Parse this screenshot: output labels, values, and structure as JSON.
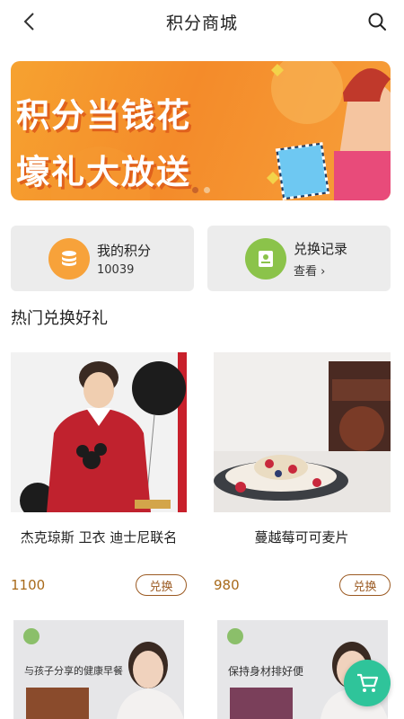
{
  "header": {
    "title": "积分商城",
    "back_icon": "back-arrow-icon",
    "search_icon": "search-icon"
  },
  "banner": {
    "line1": "积分当钱花",
    "line2": "壕礼大放送",
    "active_slide": 1,
    "slide_count": 2
  },
  "cards": [
    {
      "label": "我的积分",
      "value": "10039",
      "icon": "coins-icon",
      "icon_color": "#f7a23a"
    },
    {
      "label": "兑换记录",
      "value": "查看 ›",
      "icon": "record-icon",
      "icon_color": "#8bc34a"
    }
  ],
  "section": {
    "title": "热门兑换好礼"
  },
  "products": [
    {
      "name": "杰克琼斯 卫衣 迪士尼联名",
      "price": "1100",
      "button": "兑换"
    },
    {
      "name": "蔓越莓可可麦片",
      "price": "980",
      "button": "兑换"
    }
  ],
  "lower_products": [
    {
      "caption": "与孩子分享的健康早餐"
    },
    {
      "caption": "保持身材排好便"
    }
  ],
  "fab": {
    "icon": "cart-icon",
    "color": "#2fc49a"
  }
}
